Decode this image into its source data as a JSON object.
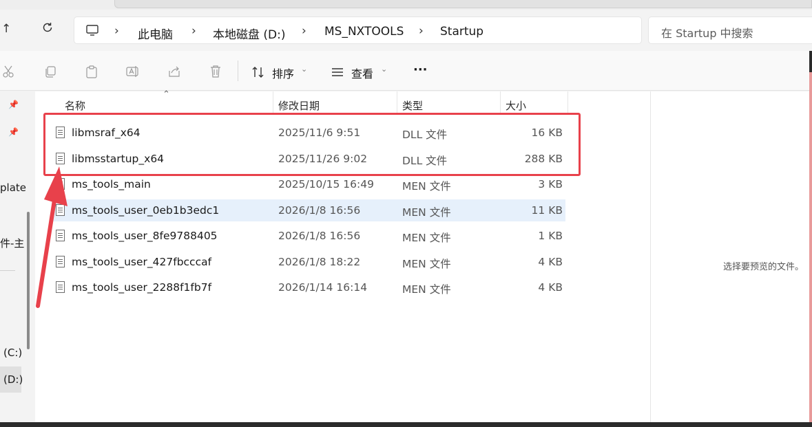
{
  "nav": {
    "up_icon": "arrow-up-icon",
    "refresh_icon": "refresh-icon"
  },
  "breadcrumb": {
    "computer_icon": "monitor-icon",
    "items": [
      "此电脑",
      "本地磁盘 (D:)",
      "MS_NXTOOLS",
      "Startup"
    ]
  },
  "search": {
    "placeholder": "在 Startup 中搜索"
  },
  "toolbar": {
    "icons": [
      "cut-icon",
      "copy-icon",
      "paste-icon",
      "rename-icon",
      "share-icon",
      "delete-icon"
    ],
    "sort_label": "排序",
    "view_label": "查看",
    "more_label": "···"
  },
  "sidebar": {
    "items": [
      "plate",
      "件-主",
      "(C:)",
      "(D:)"
    ]
  },
  "columns": {
    "name": "名称",
    "date": "修改日期",
    "type": "类型",
    "size": "大小"
  },
  "files": [
    {
      "name": "libmsraf_x64",
      "date": "2025/11/6 9:51",
      "type": "DLL 文件",
      "size": "16 KB"
    },
    {
      "name": "libmsstartup_x64",
      "date": "2025/11/26 9:02",
      "type": "DLL 文件",
      "size": "288 KB"
    },
    {
      "name": "ms_tools_main",
      "date": "2025/10/15 16:49",
      "type": "MEN 文件",
      "size": "3 KB"
    },
    {
      "name": "ms_tools_user_0eb1b3edc1",
      "date": "2026/1/8 16:56",
      "type": "MEN 文件",
      "size": "11 KB"
    },
    {
      "name": "ms_tools_user_8fe9788405",
      "date": "2026/1/8 16:56",
      "type": "MEN 文件",
      "size": "1 KB"
    },
    {
      "name": "ms_tools_user_427fbcccaf",
      "date": "2026/1/8 18:22",
      "type": "MEN 文件",
      "size": "4 KB"
    },
    {
      "name": "ms_tools_user_2288f1fb7f",
      "date": "2026/1/14 16:14",
      "type": "MEN 文件",
      "size": "4 KB"
    }
  ],
  "preview": {
    "text": "选择要预览的文件。"
  },
  "annotation": {
    "color": "#e8414b"
  }
}
